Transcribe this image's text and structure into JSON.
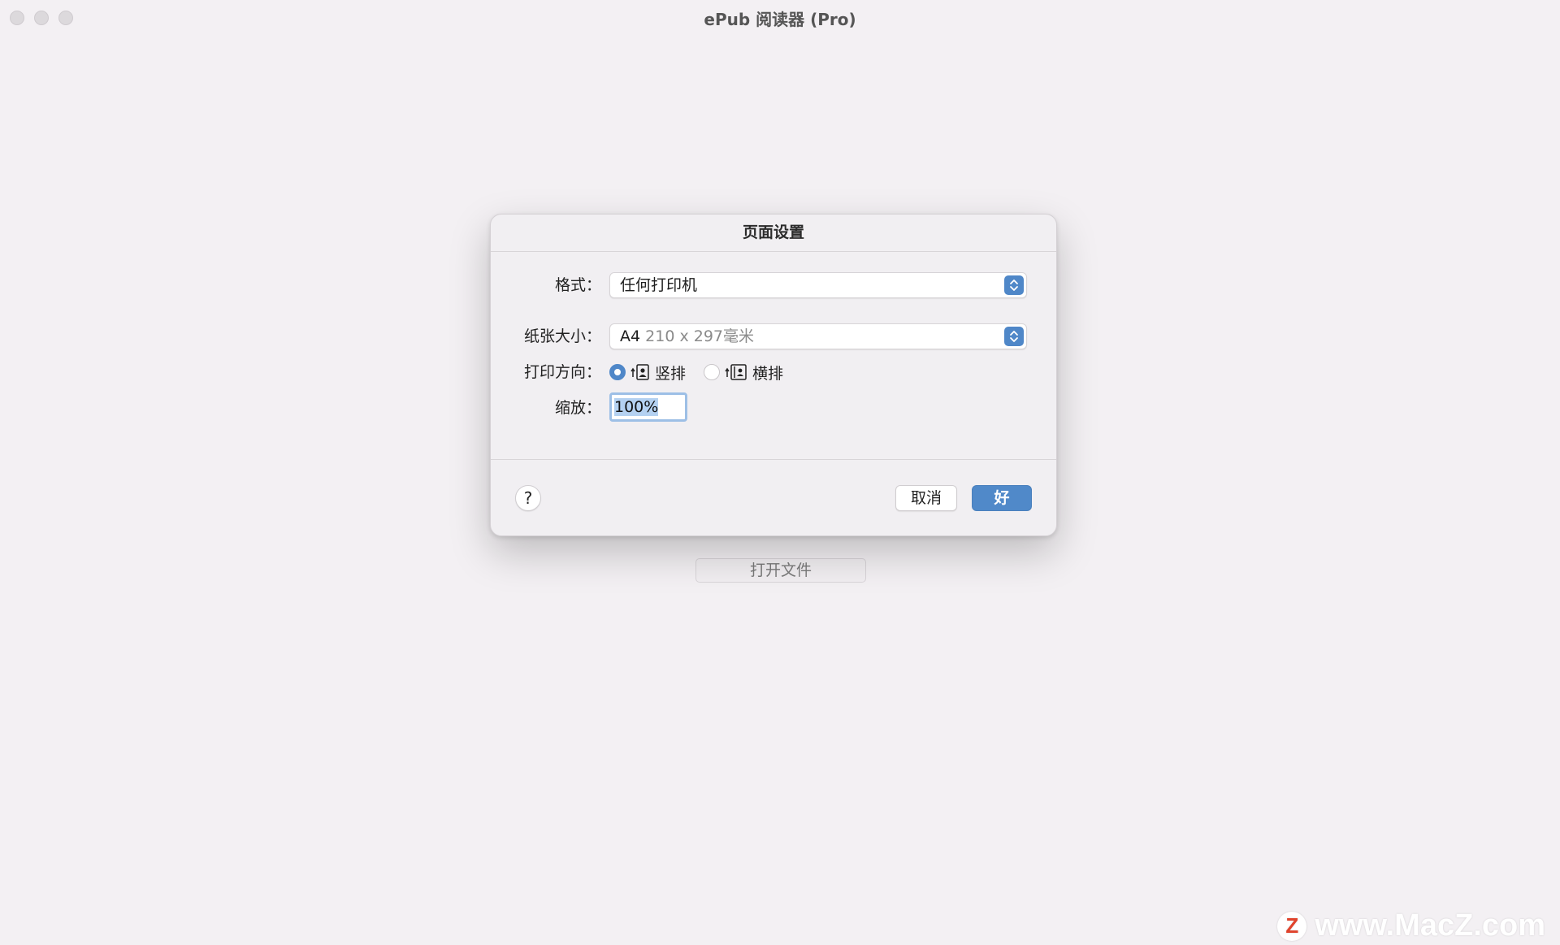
{
  "window": {
    "title": "ePub 阅读器 (Pro)"
  },
  "background": {
    "open_file_label": "打开文件"
  },
  "dialog": {
    "title": "页面设置",
    "format": {
      "label": "格式：",
      "value": "任何打印机"
    },
    "paper_size": {
      "label": "纸张大小：",
      "value_main": "A4",
      "value_detail": "210 x 297毫米"
    },
    "orientation": {
      "label": "打印方向：",
      "options": [
        {
          "label": "竖排",
          "selected": true,
          "icon": "portrait-orientation-icon"
        },
        {
          "label": "横排",
          "selected": false,
          "icon": "landscape-orientation-icon"
        }
      ]
    },
    "scale": {
      "label": "缩放：",
      "value": "100%"
    },
    "help_label": "?",
    "cancel_label": "取消",
    "ok_label": "好"
  },
  "watermark": {
    "logo_letter": "Z",
    "text": "www.MacZ.com"
  },
  "colors": {
    "accent": "#4f87c8",
    "background": "#f3f0f3"
  }
}
